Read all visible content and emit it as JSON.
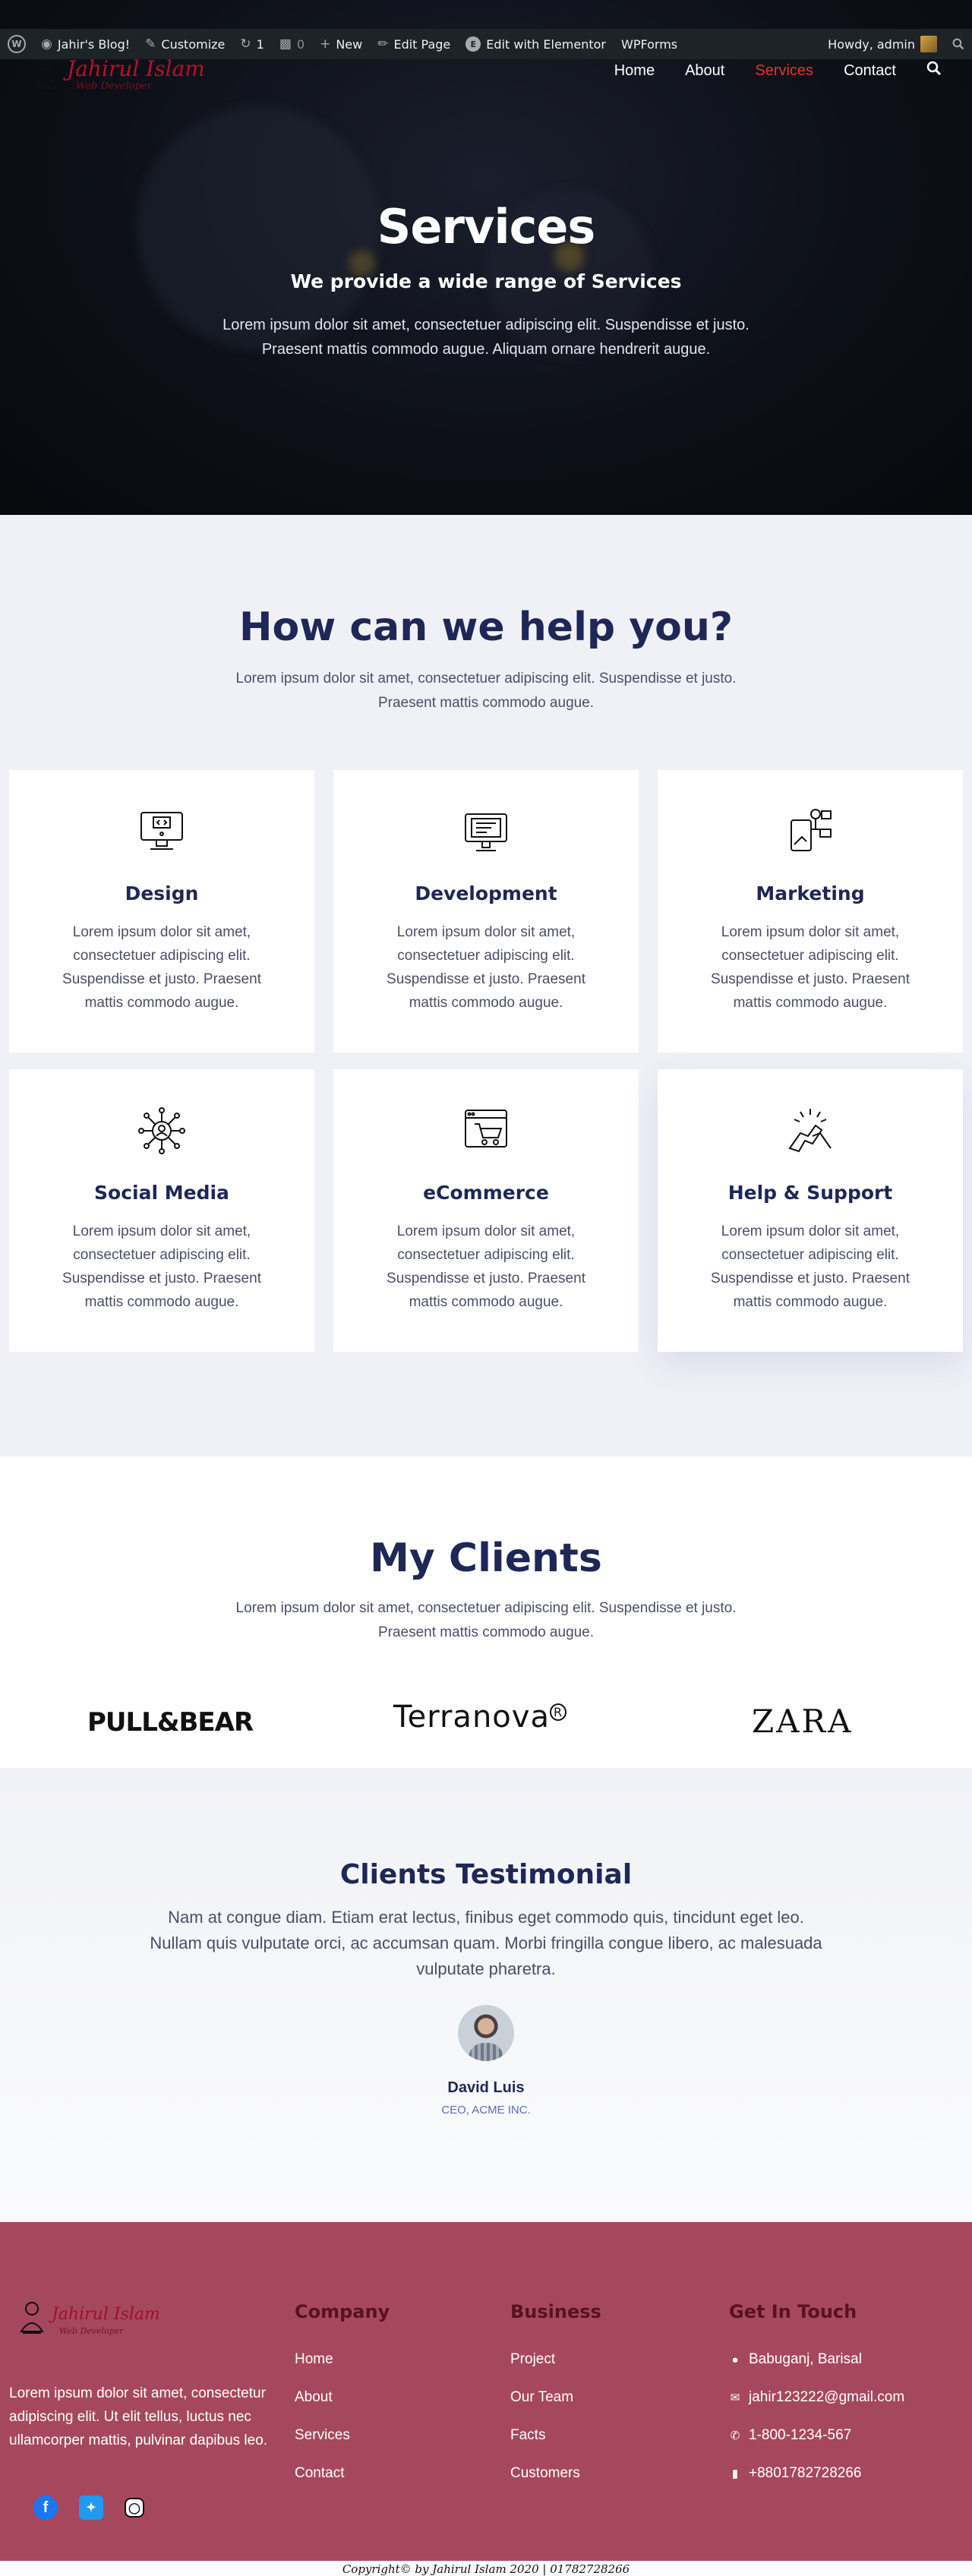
{
  "adminbar": {
    "site_name": "Jahir's Blog!",
    "customize": "Customize",
    "updates_count": "1",
    "comments_count": "0",
    "new": "New",
    "edit_page": "Edit Page",
    "edit_elementor": "Edit with Elementor",
    "wpforms": "WPForms",
    "greeting": "Howdy, admin"
  },
  "brand": {
    "name": "Jahirul Islam",
    "tagline": "Web Developer"
  },
  "nav": {
    "items": [
      {
        "label": "Home"
      },
      {
        "label": "About"
      },
      {
        "label": "Services",
        "active": true
      },
      {
        "label": "Contact"
      }
    ]
  },
  "hero": {
    "title": "Services",
    "subtitle": "We provide a wide range of Services",
    "text": "Lorem ipsum dolor sit amet, consectetuer adipiscing elit. Suspendisse et justo. Praesent mattis commodo augue. Aliquam ornare hendrerit augue."
  },
  "services": {
    "title": "How can we help you?",
    "text": "Lorem ipsum dolor sit amet, consectetuer adipiscing elit. Suspendisse et justo. Praesent mattis commodo augue.",
    "cards": [
      {
        "title": "Design",
        "icon": "design-monitor-icon",
        "text": "Lorem ipsum dolor sit amet, consectetuer adipiscing elit. Suspendisse et justo. Praesent mattis commodo augue."
      },
      {
        "title": "Development",
        "icon": "development-monitor-icon",
        "text": "Lorem ipsum dolor sit amet, consectetuer adipiscing elit. Suspendisse et justo. Praesent mattis commodo augue."
      },
      {
        "title": "Marketing",
        "icon": "marketing-icon",
        "text": "Lorem ipsum dolor sit amet, consectetuer adipiscing elit. Suspendisse et justo. Praesent mattis commodo augue."
      },
      {
        "title": "Social Media",
        "icon": "social-media-network-icon",
        "text": "Lorem ipsum dolor sit amet, consectetuer adipiscing elit. Suspendisse et justo. Praesent mattis commodo augue."
      },
      {
        "title": "eCommerce",
        "icon": "ecommerce-cart-icon",
        "text": "Lorem ipsum dolor sit amet, consectetuer adipiscing elit. Suspendisse et justo. Praesent mattis commodo augue."
      },
      {
        "title": "Help & Support",
        "icon": "handshake-support-icon",
        "text": "Lorem ipsum dolor sit amet, consectetuer adipiscing elit. Suspendisse et justo. Praesent mattis commodo augue."
      }
    ]
  },
  "clients": {
    "title": "My Clients",
    "text": "Lorem ipsum dolor sit amet, consectetuer adipiscing elit. Suspendisse et justo. Praesent mattis commodo augue.",
    "brands": [
      "PULL&BEAR",
      "Terranova",
      "ZARA"
    ]
  },
  "testimonial": {
    "title": "Clients Testimonial",
    "quote": "Nam at congue diam. Etiam erat lectus, finibus eget commodo quis, tincidunt eget leo. Nullam quis vulputate orci, ac accumsan quam. Morbi fringilla congue libero, ac malesuada vulputate pharetra.",
    "name": "David Luis",
    "role": "CEO, ACME INC."
  },
  "footer": {
    "about": "Lorem ipsum dolor sit amet, consectetur adipiscing elit. Ut elit tellus, luctus nec ullamcorper mattis, pulvinar dapibus leo.",
    "company": {
      "title": "Company",
      "links": [
        "Home",
        "About",
        "Services",
        "Contact"
      ]
    },
    "business": {
      "title": "Business",
      "links": [
        "Project",
        "Our Team",
        "Facts",
        "Customers"
      ]
    },
    "contact": {
      "title": "Get In Touch",
      "address": "Babuganj, Barisal",
      "email": "jahir123222@gmail.com",
      "phone": "1-800-1234-567",
      "mobile": "+8801782728266"
    },
    "copyright": "Copyright© by Jahirul Islam 2020 | 01782728266"
  },
  "colors": {
    "nav_active": "#e8342c",
    "heading": "#1f2757",
    "footer_bg": "#a5485e",
    "adminbar_bg": "#1d2327"
  }
}
